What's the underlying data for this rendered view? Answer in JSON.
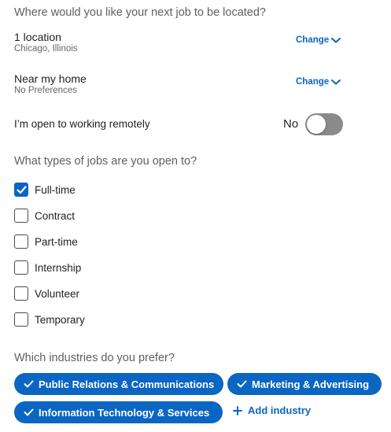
{
  "location_question": "Where would you like your next job to be located?",
  "locations": [
    {
      "title": "1 location",
      "subtitle": "Chicago, Illinois",
      "action": "Change"
    },
    {
      "title": "Near my home",
      "subtitle": "No Preferences",
      "action": "Change"
    }
  ],
  "remote": {
    "label": "I’m open to working remotely",
    "state_label": "No",
    "enabled": false
  },
  "job_types_question": "What types of jobs are you open to?",
  "job_types": [
    {
      "label": "Full-time",
      "checked": true
    },
    {
      "label": "Contract",
      "checked": false
    },
    {
      "label": "Part-time",
      "checked": false
    },
    {
      "label": "Internship",
      "checked": false
    },
    {
      "label": "Volunteer",
      "checked": false
    },
    {
      "label": "Temporary",
      "checked": false
    }
  ],
  "industries_question": "Which industries do you prefer?",
  "industries": [
    "Public Relations & Communications",
    "Marketing & Advertising",
    "Information Technology & Services"
  ],
  "add_industry_label": "Add industry",
  "colors": {
    "accent": "#0a66c2",
    "toggle_off": "#8a8a8a",
    "muted_text": "#5f5f5f"
  }
}
